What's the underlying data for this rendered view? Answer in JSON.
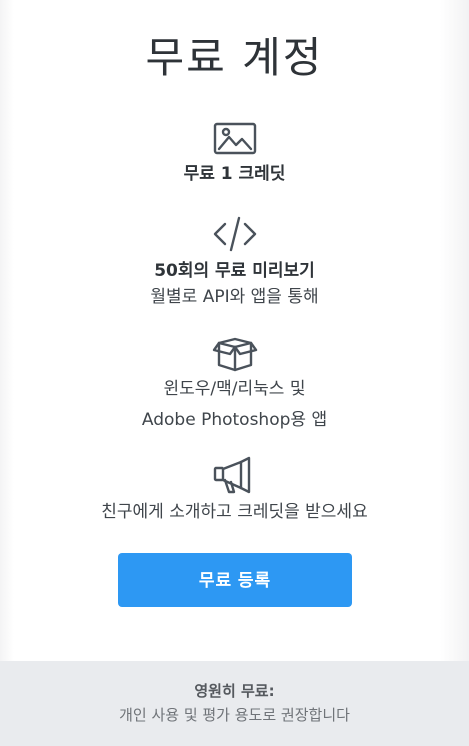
{
  "title": "무료 계정",
  "features": [
    {
      "icon": "image-icon",
      "bold": "무료 1 크레딧",
      "lines": []
    },
    {
      "icon": "code-icon",
      "bold": "50회의 무료 미리보기",
      "lines": [
        "월별로 API와 앱을 통해"
      ]
    },
    {
      "icon": "box-icon",
      "bold": "",
      "lines": [
        "윈도우/맥/리눅스 및",
        "Adobe Photoshop용 앱"
      ]
    },
    {
      "icon": "megaphone-icon",
      "bold": "",
      "lines": [
        "친구에게 소개하고 크레딧을 받으세요"
      ]
    }
  ],
  "cta_label": "무료 등록",
  "footer": {
    "bold": "영원히 무료:",
    "text": "개인 사용 및 평가 용도로 권장합니다"
  },
  "colors": {
    "accent": "#2d98f3",
    "footer_bg": "#e9ebee",
    "icon_stroke": "#4a525b"
  }
}
